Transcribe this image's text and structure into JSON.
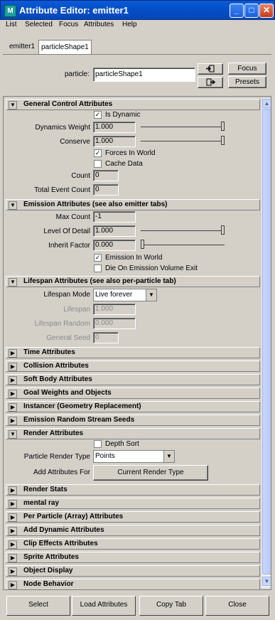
{
  "window": {
    "title": "Attribute Editor: emitter1"
  },
  "menu": [
    "List",
    "Selected",
    "Focus",
    "Attributes",
    "Help"
  ],
  "tabs": [
    "emitter1",
    "particleShape1"
  ],
  "node": {
    "label": "particle:",
    "value": "particleShape1",
    "focus_label": "Focus",
    "presets_label": "Presets"
  },
  "sections": {
    "general": {
      "title": "General Control Attributes",
      "is_dynamic": "Is Dynamic",
      "dynamics_weight_label": "Dynamics Weight",
      "dynamics_weight_value": "1.000",
      "conserve_label": "Conserve",
      "conserve_value": "1.000",
      "forces_in_world": "Forces In World",
      "cache_data": "Cache Data",
      "count_label": "Count",
      "count_value": "0",
      "total_event_count_label": "Total Event Count",
      "total_event_count_value": "0"
    },
    "emission": {
      "title": "Emission Attributes (see also emitter tabs)",
      "max_count_label": "Max Count",
      "max_count_value": "-1",
      "lod_label": "Level Of Detail",
      "lod_value": "1.000",
      "inherit_factor_label": "Inherit Factor",
      "inherit_factor_value": "0.000",
      "emission_in_world": "Emission In World",
      "die_on_exit": "Die On Emission Volume Exit"
    },
    "lifespan": {
      "title": "Lifespan Attributes (see also per-particle tab)",
      "mode_label": "Lifespan Mode",
      "mode_value": "Live forever",
      "lifespan_label": "Lifespan",
      "lifespan_value": "1.000",
      "lifespan_random_label": "Lifespan Random",
      "lifespan_random_value": "0.000",
      "general_seed_label": "General Seed",
      "general_seed_value": "0"
    },
    "collapsed_a": [
      "Time Attributes",
      "Collision Attributes",
      "Soft Body Attributes",
      "Goal Weights and Objects",
      "Instancer (Geometry Replacement)",
      "Emission Random Stream Seeds"
    ],
    "render": {
      "title": "Render Attributes",
      "depth_sort": "Depth Sort",
      "render_type_label": "Particle Render Type",
      "render_type_value": "Points",
      "add_attrs_label": "Add Attributes For",
      "add_attrs_button": "Current Render Type"
    },
    "collapsed_b": [
      "Render Stats",
      "mental ray",
      "Per Particle (Array) Attributes",
      "Add Dynamic Attributes",
      "Clip Effects Attributes",
      "Sprite Attributes",
      "Object Display",
      "Node Behavior"
    ]
  },
  "bottom_buttons": [
    "Select",
    "Load Attributes",
    "Copy Tab",
    "Close"
  ],
  "colors": {
    "title_bar": "#0550c8",
    "window_bg": "#d4d0c8"
  }
}
